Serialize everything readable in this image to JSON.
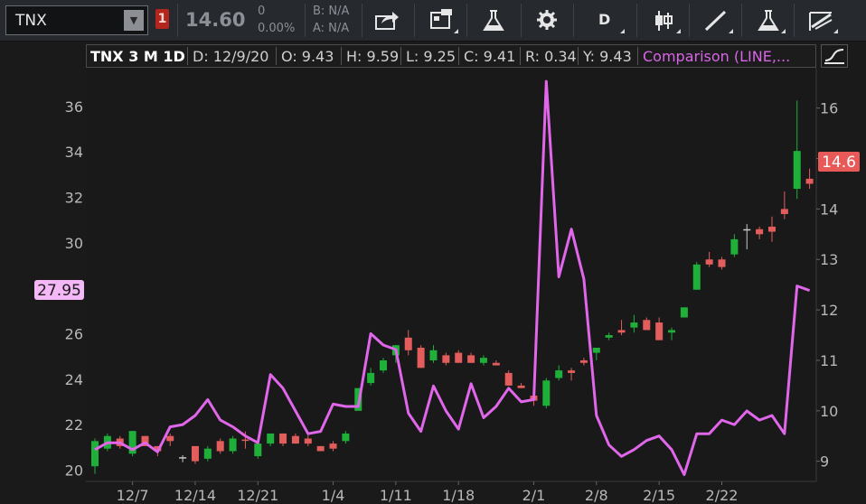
{
  "toolbar": {
    "symbol": "TNX",
    "alert_count": "1",
    "last_price": "14.60",
    "net_change": "0",
    "pct_change": "0.00%",
    "bid": "B: N/A",
    "ask": "A: N/A",
    "chart_style_label": "D",
    "buttons": [
      "share-icon",
      "notes-icon",
      "studies-flask-icon",
      "settings-gear-icon",
      "chart-style-d",
      "candle-icon",
      "drawing-line-icon",
      "strategies-flask-icon",
      "drawing-tools-icon"
    ]
  },
  "header": {
    "title": "TNX 3 M 1D",
    "date": "D: 12/9/20",
    "open": "O: 9.43",
    "high": "H: 9.59",
    "low": "L: 9.25",
    "close": "C: 9.41",
    "range": "R: 0.34",
    "y": "Y: 9.43",
    "comparison": "Comparison (LINE,..."
  },
  "colors": {
    "up": "#1fb03a",
    "down": "#e35d5d",
    "comparison_line": "#e066ea",
    "background": "#1a1a1a"
  },
  "chart_data": {
    "type": "candlestick",
    "title": "TNX 3 M 1D",
    "x_tick_labels": [
      "12/7",
      "12/14",
      "12/21",
      "1/4",
      "1/11",
      "1/18",
      "2/1",
      "2/8",
      "2/15",
      "2/22"
    ],
    "x_tick_bar_index": [
      3,
      8,
      13,
      19,
      24,
      29,
      35,
      40,
      45,
      50
    ],
    "left_axis": {
      "ticks": [
        20,
        22,
        24,
        26,
        28,
        30,
        32,
        34,
        36
      ],
      "range": [
        19.5,
        37.7
      ],
      "label": ""
    },
    "right_axis": {
      "ticks": [
        9,
        10,
        11,
        12,
        13,
        14,
        15,
        16
      ],
      "range": [
        8.6,
        16.8
      ],
      "label": ""
    },
    "price_marker_right": "14.6",
    "price_marker_left": "27.95",
    "candles": [
      {
        "o": 8.9,
        "h": 9.45,
        "l": 8.75,
        "c": 9.4
      },
      {
        "o": 9.25,
        "h": 9.55,
        "l": 9.2,
        "c": 9.5
      },
      {
        "o": 9.45,
        "h": 9.5,
        "l": 9.25,
        "c": 9.3
      },
      {
        "o": 9.15,
        "h": 9.6,
        "l": 9.1,
        "c": 9.6
      },
      {
        "o": 9.5,
        "h": 9.5,
        "l": 9.3,
        "c": 9.3
      },
      {
        "o": 9.3,
        "h": 9.3,
        "l": 9.1,
        "c": 9.2
      },
      {
        "o": 9.5,
        "h": 9.55,
        "l": 9.3,
        "c": 9.4
      },
      {
        "o": 9.08,
        "h": 9.12,
        "l": 8.98,
        "c": 9.08
      },
      {
        "o": 9.3,
        "h": 9.3,
        "l": 8.95,
        "c": 9.0
      },
      {
        "o": 9.05,
        "h": 9.3,
        "l": 9.0,
        "c": 9.25
      },
      {
        "o": 9.4,
        "h": 9.45,
        "l": 9.15,
        "c": 9.2
      },
      {
        "o": 9.2,
        "h": 9.5,
        "l": 9.15,
        "c": 9.45
      },
      {
        "o": 9.43,
        "h": 9.59,
        "l": 9.25,
        "c": 9.41
      },
      {
        "o": 9.1,
        "h": 9.4,
        "l": 9.05,
        "c": 9.35
      },
      {
        "o": 9.35,
        "h": 9.55,
        "l": 9.3,
        "c": 9.55
      },
      {
        "o": 9.55,
        "h": 9.55,
        "l": 9.3,
        "c": 9.35
      },
      {
        "o": 9.5,
        "h": 9.55,
        "l": 9.35,
        "c": 9.35
      },
      {
        "o": 9.45,
        "h": 9.55,
        "l": 9.3,
        "c": 9.35
      },
      {
        "o": 9.3,
        "h": 9.3,
        "l": 9.2,
        "c": 9.2
      },
      {
        "o": 9.35,
        "h": 9.4,
        "l": 9.2,
        "c": 9.25
      },
      {
        "o": 9.4,
        "h": 9.6,
        "l": 9.35,
        "c": 9.55
      },
      {
        "o": 10.0,
        "h": 10.45,
        "l": 10.0,
        "c": 10.45
      },
      {
        "o": 10.55,
        "h": 10.85,
        "l": 10.5,
        "c": 10.75
      },
      {
        "o": 10.8,
        "h": 11.05,
        "l": 10.75,
        "c": 11.0
      },
      {
        "o": 11.1,
        "h": 11.3,
        "l": 10.95,
        "c": 11.3
      },
      {
        "o": 11.45,
        "h": 11.6,
        "l": 11.1,
        "c": 11.2
      },
      {
        "o": 11.25,
        "h": 11.3,
        "l": 10.85,
        "c": 10.85
      },
      {
        "o": 11.0,
        "h": 11.3,
        "l": 10.95,
        "c": 11.2
      },
      {
        "o": 11.1,
        "h": 11.15,
        "l": 10.9,
        "c": 10.95
      },
      {
        "o": 11.15,
        "h": 11.2,
        "l": 10.95,
        "c": 10.95
      },
      {
        "o": 11.1,
        "h": 11.15,
        "l": 10.95,
        "c": 10.95
      },
      {
        "o": 10.95,
        "h": 11.1,
        "l": 10.9,
        "c": 11.05
      },
      {
        "o": 10.95,
        "h": 11.0,
        "l": 10.9,
        "c": 10.9
      },
      {
        "o": 10.75,
        "h": 10.8,
        "l": 10.5,
        "c": 10.5
      },
      {
        "o": 10.5,
        "h": 10.55,
        "l": 10.45,
        "c": 10.45
      },
      {
        "o": 10.3,
        "h": 10.45,
        "l": 10.1,
        "c": 10.2
      },
      {
        "o": 10.1,
        "h": 10.65,
        "l": 10.05,
        "c": 10.6
      },
      {
        "o": 10.65,
        "h": 10.9,
        "l": 10.6,
        "c": 10.8
      },
      {
        "o": 10.8,
        "h": 10.85,
        "l": 10.6,
        "c": 10.75
      },
      {
        "o": 11.0,
        "h": 11.05,
        "l": 10.9,
        "c": 10.95
      },
      {
        "o": 11.15,
        "h": 11.25,
        "l": 11.0,
        "c": 11.25
      },
      {
        "o": 11.45,
        "h": 11.55,
        "l": 11.4,
        "c": 11.5
      },
      {
        "o": 11.6,
        "h": 11.8,
        "l": 11.5,
        "c": 11.55
      },
      {
        "o": 11.65,
        "h": 11.9,
        "l": 11.55,
        "c": 11.75
      },
      {
        "o": 11.8,
        "h": 11.85,
        "l": 11.6,
        "c": 11.6
      },
      {
        "o": 11.75,
        "h": 11.85,
        "l": 11.4,
        "c": 11.4
      },
      {
        "o": 11.55,
        "h": 11.65,
        "l": 11.4,
        "c": 11.6
      },
      {
        "o": 11.85,
        "h": 12.05,
        "l": 11.85,
        "c": 12.05
      },
      {
        "o": 12.4,
        "h": 12.95,
        "l": 12.4,
        "c": 12.9
      },
      {
        "o": 13.0,
        "h": 13.15,
        "l": 12.85,
        "c": 12.9
      },
      {
        "o": 13.0,
        "h": 13.05,
        "l": 12.8,
        "c": 12.85
      },
      {
        "o": 13.1,
        "h": 13.5,
        "l": 13.05,
        "c": 13.4
      },
      {
        "o": 13.6,
        "h": 13.7,
        "l": 13.2,
        "c": 13.6
      },
      {
        "o": 13.6,
        "h": 13.65,
        "l": 13.4,
        "c": 13.5
      },
      {
        "o": 13.65,
        "h": 13.85,
        "l": 13.35,
        "c": 13.55
      },
      {
        "o": 14.0,
        "h": 14.35,
        "l": 13.8,
        "c": 13.9
      },
      {
        "o": 14.4,
        "h": 16.15,
        "l": 14.2,
        "c": 15.15
      },
      {
        "o": 14.6,
        "h": 14.8,
        "l": 14.4,
        "c": 14.5
      }
    ],
    "comparison_series": {
      "name": "Comparison",
      "axis": "left",
      "values": [
        20.9,
        21.2,
        21.2,
        20.9,
        21.2,
        20.8,
        21.9,
        22.0,
        22.4,
        23.1,
        22.2,
        21.9,
        21.5,
        21.2,
        24.2,
        23.6,
        22.6,
        21.6,
        21.7,
        22.9,
        22.8,
        22.8,
        26.0,
        25.5,
        25.3,
        22.5,
        21.7,
        23.7,
        22.6,
        21.8,
        23.8,
        22.3,
        22.8,
        23.6,
        23.0,
        23.1,
        37.1,
        28.5,
        30.6,
        28.4,
        22.4,
        21.1,
        20.6,
        20.9,
        21.3,
        21.5,
        20.9,
        19.8,
        21.6,
        21.6,
        22.2,
        22.0,
        22.6,
        22.2,
        22.4,
        21.6,
        28.1,
        27.9
      ]
    },
    "legend": "header",
    "grid": false
  }
}
